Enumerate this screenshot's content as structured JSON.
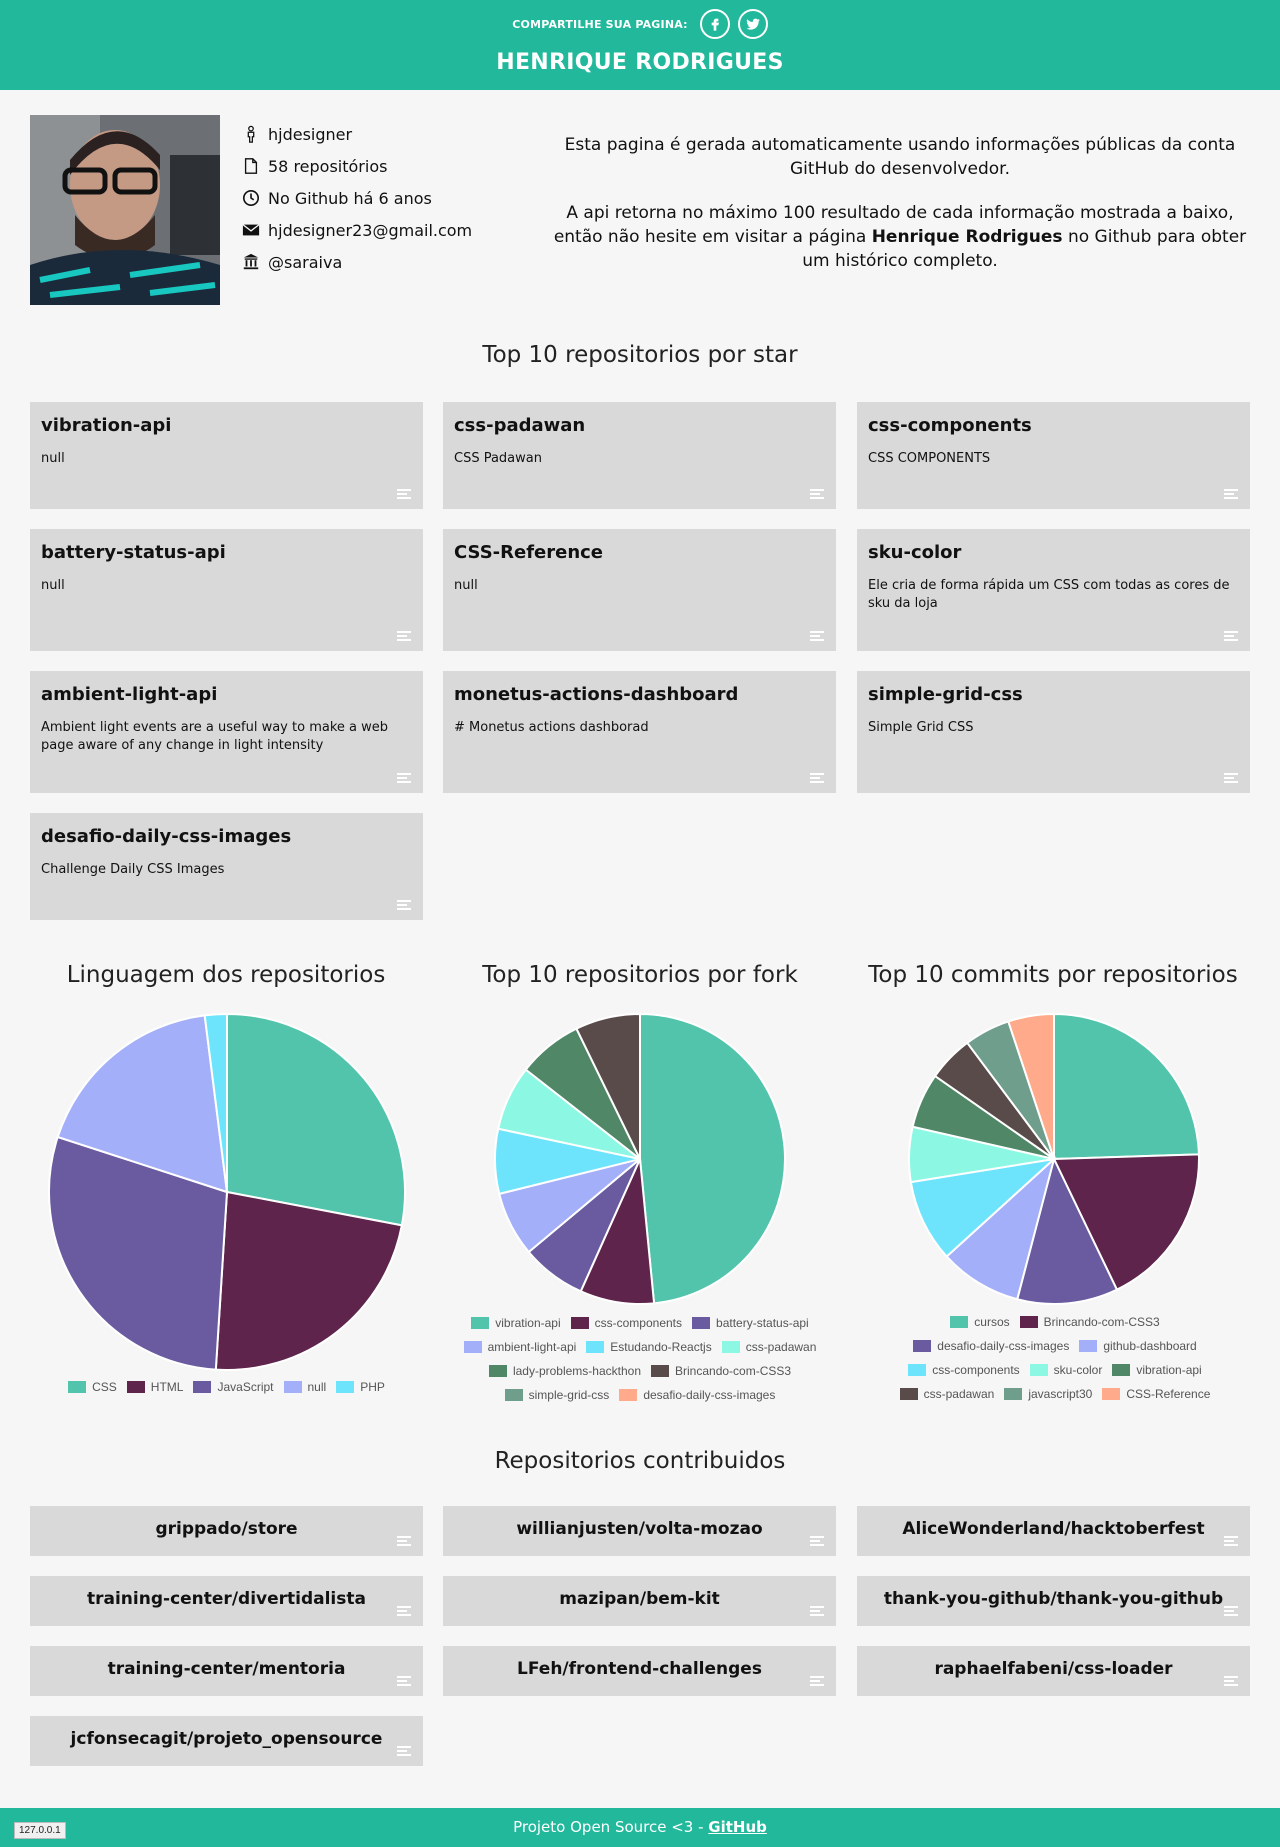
{
  "header": {
    "share_label": "COMPARTILHE SUA PAGINA:",
    "share_buttons": [
      {
        "icon": "facebook-icon"
      },
      {
        "icon": "twitter-icon"
      }
    ],
    "owner_name": "HENRIQUE RODRIGUES",
    "bar_color": "#21b89b"
  },
  "profile": {
    "username": "hjdesigner",
    "repos": "58 repositórios",
    "github_age": "No Github há 6 anos",
    "email": "hjdesigner23@gmail.com",
    "company": "@saraiva"
  },
  "intro": {
    "p1": "Esta pagina é gerada automaticamente usando informações públicas da conta GitHub do desenvolvedor.",
    "p2_before": "A api retorna no máximo 100 resultado de cada informação mostrada a baixo, então não hesite em visitar a página ",
    "p2_name": "Henrique Rodrigues",
    "p2_after": " no Github para obter um histórico completo."
  },
  "top_stars": {
    "title": "Top 10 repositorios por star",
    "repos": [
      {
        "name": "vibration-api",
        "desc": "null"
      },
      {
        "name": "css-padawan",
        "desc": "CSS Padawan"
      },
      {
        "name": "css-components",
        "desc": "CSS COMPONENTS"
      },
      {
        "name": "battery-status-api",
        "desc": "null"
      },
      {
        "name": "CSS-Reference",
        "desc": "null"
      },
      {
        "name": "sku-color",
        "desc": "Ele cria de forma rápida um CSS com todas as cores de sku da loja"
      },
      {
        "name": "ambient-light-api",
        "desc": "Ambient light events are a useful way to make a web page aware of any change in light intensity"
      },
      {
        "name": "monetus-actions-dashboard",
        "desc": "# Monetus actions dashborad"
      },
      {
        "name": "simple-grid-css",
        "desc": "Simple Grid CSS"
      },
      {
        "name": "desafio-daily-css-images",
        "desc": "Challenge Daily CSS Images"
      }
    ]
  },
  "chart_data": [
    {
      "type": "pie",
      "title": "Linguagem dos repositorios",
      "categories": [
        "CSS",
        "HTML",
        "JavaScript",
        "null",
        "PHP"
      ],
      "values": [
        28,
        23,
        29,
        18,
        2
      ],
      "colors": [
        "#52c4ab",
        "#5e244b",
        "#6a5aa0",
        "#a4aff9",
        "#6de4fb"
      ],
      "legend": "bottom"
    },
    {
      "type": "pie",
      "title": "Top 10 repositorios por fork",
      "categories": [
        "vibration-api",
        "css-components",
        "battery-status-api",
        "ambient-light-api",
        "Estudando-Reactjs",
        "css-padawan",
        "lady-problems-hackthon",
        "Brincando-com-CSS3",
        "simple-grid-css",
        "desafio-daily-css-images"
      ],
      "values": [
        47,
        8,
        7,
        7,
        7,
        7,
        7,
        7,
        0,
        0
      ],
      "colors": [
        "#52c4ab",
        "#5e244b",
        "#6a5aa0",
        "#a4aff9",
        "#6de4fb",
        "#8cf7e3",
        "#4f8767",
        "#5a4b4b",
        "#6f9e8d",
        "#ffaa8a"
      ],
      "legend": "bottom"
    },
    {
      "type": "pie",
      "title": "Top 10 commits por repositorios",
      "categories": [
        "cursos",
        "Brincando-com-CSS3",
        "desafio-daily-css-images",
        "github-dashboard",
        "css-components",
        "sku-color",
        "vibration-api",
        "css-padawan",
        "javascript30",
        "CSS-Reference"
      ],
      "values": [
        24,
        18,
        11,
        9,
        9,
        6,
        6,
        5,
        5,
        5
      ],
      "colors": [
        "#52c4ab",
        "#5e244b",
        "#6a5aa0",
        "#a4aff9",
        "#6de4fb",
        "#8cf7e3",
        "#4f8767",
        "#5a4b4b",
        "#6f9e8d",
        "#ffaa8a"
      ],
      "legend": "bottom"
    }
  ],
  "contributed": {
    "title": "Repositorios contribuidos",
    "repos": [
      "grippado/store",
      "willianjusten/volta-mozao",
      "AliceWonderland/hacktoberfest",
      "training-center/divertidalista",
      "mazipan/bem-kit",
      "thank-you-github/thank-you-github",
      "training-center/mentoria",
      "LFeh/frontend-challenges",
      "raphaelfabeni/css-loader",
      "jcfonsecagit/projeto_opensource"
    ]
  },
  "footer": {
    "text": "Projeto Open Source <3 - ",
    "link": "GitHub"
  },
  "status_tip": "127.0.0.1"
}
